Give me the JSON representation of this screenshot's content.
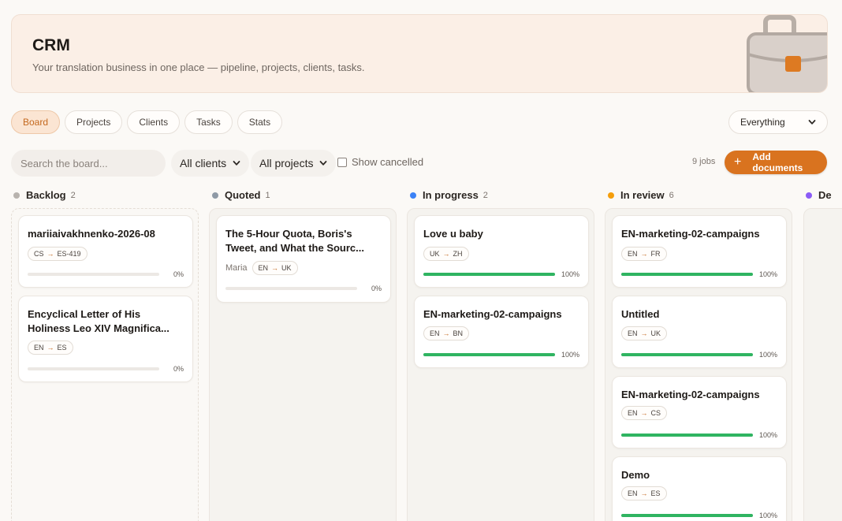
{
  "header": {
    "title": "CRM",
    "subtitle": "Your translation business in one place — pipeline, projects, clients, tasks."
  },
  "tabs": [
    {
      "label": "Board",
      "active": true
    },
    {
      "label": "Projects",
      "active": false
    },
    {
      "label": "Clients",
      "active": false
    },
    {
      "label": "Tasks",
      "active": false
    },
    {
      "label": "Stats",
      "active": false
    }
  ],
  "scope": {
    "selected": "Everything"
  },
  "toolbar": {
    "search_placeholder": "Search the board...",
    "clients_filter": "All clients",
    "projects_filter": "All projects",
    "show_cancelled": "Show cancelled",
    "job_count": "9 jobs",
    "add_label": "Add documents"
  },
  "colors": {
    "accent": "#d9731f",
    "progress": "#2fb461",
    "backlog": "#b8b3ae",
    "quoted": "#8f9aa6",
    "in_progress": "#3b82f6",
    "in_review": "#f59e0b",
    "done": "#8b5cf6"
  },
  "columns": [
    {
      "name": "Backlog",
      "count": "2",
      "cards": [
        {
          "title": "mariiaivakhnenko-2026-08",
          "client": "",
          "from": "CS",
          "to": "ES-419",
          "progress": 0,
          "pct": "0%"
        },
        {
          "title": "Encyclical Letter of His Holiness Leo XIV Magnifica...",
          "client": "",
          "from": "EN",
          "to": "ES",
          "progress": 0,
          "pct": "0%"
        }
      ]
    },
    {
      "name": "Quoted",
      "count": "1",
      "cards": [
        {
          "title": "The 5-Hour Quota, Boris's Tweet, and What the Sourc...",
          "client": "Maria",
          "from": "EN",
          "to": "UK",
          "progress": 0,
          "pct": "0%"
        }
      ]
    },
    {
      "name": "In progress",
      "count": "2",
      "cards": [
        {
          "title": "Love u baby",
          "client": "",
          "from": "UK",
          "to": "ZH",
          "progress": 100,
          "pct": "100%"
        },
        {
          "title": "EN-marketing-02-campaigns",
          "client": "",
          "from": "EN",
          "to": "BN",
          "progress": 100,
          "pct": "100%"
        }
      ]
    },
    {
      "name": "In review",
      "count": "6",
      "cards": [
        {
          "title": "EN-marketing-02-campaigns",
          "client": "",
          "from": "EN",
          "to": "FR",
          "progress": 100,
          "pct": "100%"
        },
        {
          "title": "Untitled",
          "client": "",
          "from": "EN",
          "to": "UK",
          "progress": 100,
          "pct": "100%"
        },
        {
          "title": "EN-marketing-02-campaigns",
          "client": "",
          "from": "EN",
          "to": "CS",
          "progress": 100,
          "pct": "100%"
        },
        {
          "title": "Demo",
          "client": "",
          "from": "EN",
          "to": "ES",
          "progress": 100,
          "pct": "100%"
        }
      ]
    },
    {
      "name": "De",
      "count": "",
      "cards": []
    }
  ],
  "lang_arrow": "→"
}
